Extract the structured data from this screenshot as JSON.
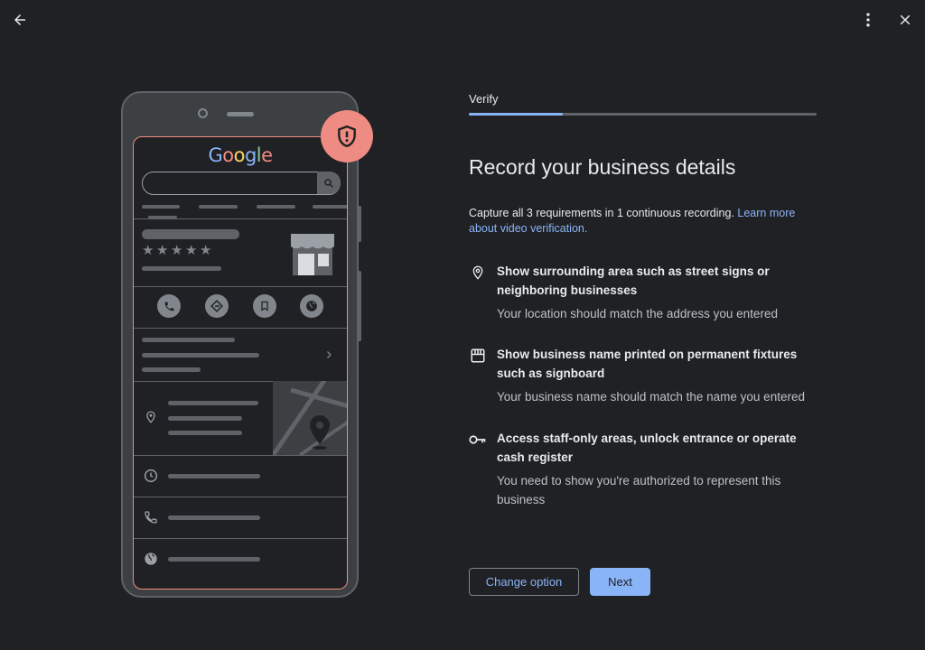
{
  "header": {
    "back_icon": "arrow-back-icon",
    "more_icon": "more-vert-icon",
    "close_icon": "close-icon"
  },
  "illustration": {
    "logo_text": "Google",
    "logo_colors": [
      "#8ab4f8",
      "#f28b82",
      "#fdd663",
      "#8ab4f8",
      "#81c995",
      "#f28b82"
    ],
    "badge_icon": "shield-alert-icon",
    "badge_color": "#ee8b82",
    "rating_stars": 5
  },
  "step": {
    "label": "Verify",
    "progress": 0.27
  },
  "main": {
    "title": "Record your business details",
    "description": "Capture all 3 requirements in 1 continuous recording.",
    "learn_more": "Learn more about video verification."
  },
  "requirements": [
    {
      "icon": "location-pin-icon",
      "title": "Show surrounding area such as street signs or neighboring businesses",
      "subtitle": "Your location should match the address you entered"
    },
    {
      "icon": "storefront-icon",
      "title": "Show business name printed on permanent fixtures such as signboard",
      "subtitle": "Your business name should match the name you entered"
    },
    {
      "icon": "key-icon",
      "title": "Access staff-only areas, unlock entrance or operate cash register",
      "subtitle": "You need to show you're authorized to represent this business"
    }
  ],
  "actions": {
    "change_option": "Change option",
    "next": "Next"
  },
  "colors": {
    "background": "#202124",
    "accent": "#8ab4f8",
    "badge": "#ee8b82"
  }
}
